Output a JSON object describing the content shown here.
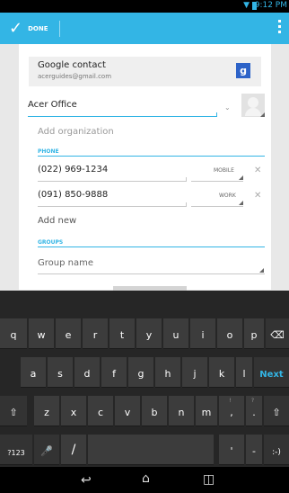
{
  "status_bar": {
    "time": "9:12 PM"
  },
  "action_bar": {
    "done_label": "DONE"
  },
  "account": {
    "type": "Google contact",
    "email": "acerguides@gmail.com",
    "logo_letter": "g"
  },
  "name_value": "Acer Office",
  "org_placeholder": "Add organization",
  "phone_section": "PHONE",
  "phones": [
    {
      "number": "(022) 969-1234",
      "type": "MOBILE"
    },
    {
      "number": "(091) 850-9888",
      "type": "WORK"
    }
  ],
  "add_new": "Add new",
  "groups_section": "GROUPS",
  "group_placeholder": "Group name",
  "keyboard": {
    "row1": [
      "q",
      "w",
      "e",
      "r",
      "t",
      "y",
      "u",
      "i",
      "o",
      "p"
    ],
    "row2": [
      "a",
      "s",
      "d",
      "f",
      "g",
      "h",
      "j",
      "k",
      "l"
    ],
    "row3": [
      "z",
      "x",
      "c",
      "v",
      "b",
      "n",
      "m"
    ],
    "next_label": "Next",
    "symbols_label": "?123",
    "slash": "/",
    "apostrophe": "'",
    "dash": "-",
    "smiley": ":-)",
    "comma": ",",
    "period": ".",
    "row3_alt": [
      "!",
      "?"
    ]
  },
  "colors": {
    "accent": "#33b5e5",
    "keyboard_bg": "#262626",
    "key_bg": "#3c3c3c"
  }
}
